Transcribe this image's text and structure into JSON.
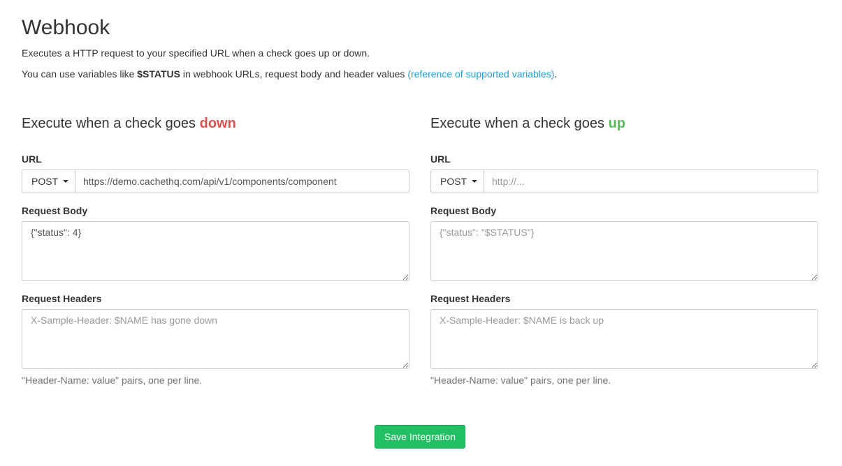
{
  "page": {
    "title": "Webhook",
    "description_line1": "Executes a HTTP request to your specified URL when a check goes up or down.",
    "description_line2_prefix": "You can use variables like ",
    "description_line2_var": "$STATUS",
    "description_line2_middle": " in webhook URLs, request body and header values ",
    "description_line2_link": "(reference of supported variables)",
    "description_line2_suffix": "."
  },
  "down": {
    "heading_prefix": "Execute when a check goes ",
    "heading_state": "down",
    "state_color": "#d9534f",
    "url_label": "URL",
    "method": "POST",
    "url_value": "https://demo.cachethq.com/api/v1/components/component",
    "url_placeholder": "",
    "body_label": "Request Body",
    "body_value": "{\"status\": 4}",
    "body_placeholder": "",
    "headers_label": "Request Headers",
    "headers_value": "",
    "headers_placeholder": "X-Sample-Header: $NAME has gone down",
    "headers_help": "\"Header-Name: value\" pairs, one per line."
  },
  "up": {
    "heading_prefix": "Execute when a check goes ",
    "heading_state": "up",
    "state_color": "#5cb85c",
    "url_label": "URL",
    "method": "POST",
    "url_value": "",
    "url_placeholder": "http://...",
    "body_label": "Request Body",
    "body_value": "",
    "body_placeholder": "{\"status\": \"$STATUS\"}",
    "headers_label": "Request Headers",
    "headers_value": "",
    "headers_placeholder": "X-Sample-Header: $NAME is back up",
    "headers_help": "\"Header-Name: value\" pairs, one per line."
  },
  "actions": {
    "save_label": "Save Integration",
    "save_color": "#22c065"
  },
  "icons": {
    "method_dropdown": "caret-down-icon"
  },
  "colors": {
    "link": "#1a9fd6"
  }
}
